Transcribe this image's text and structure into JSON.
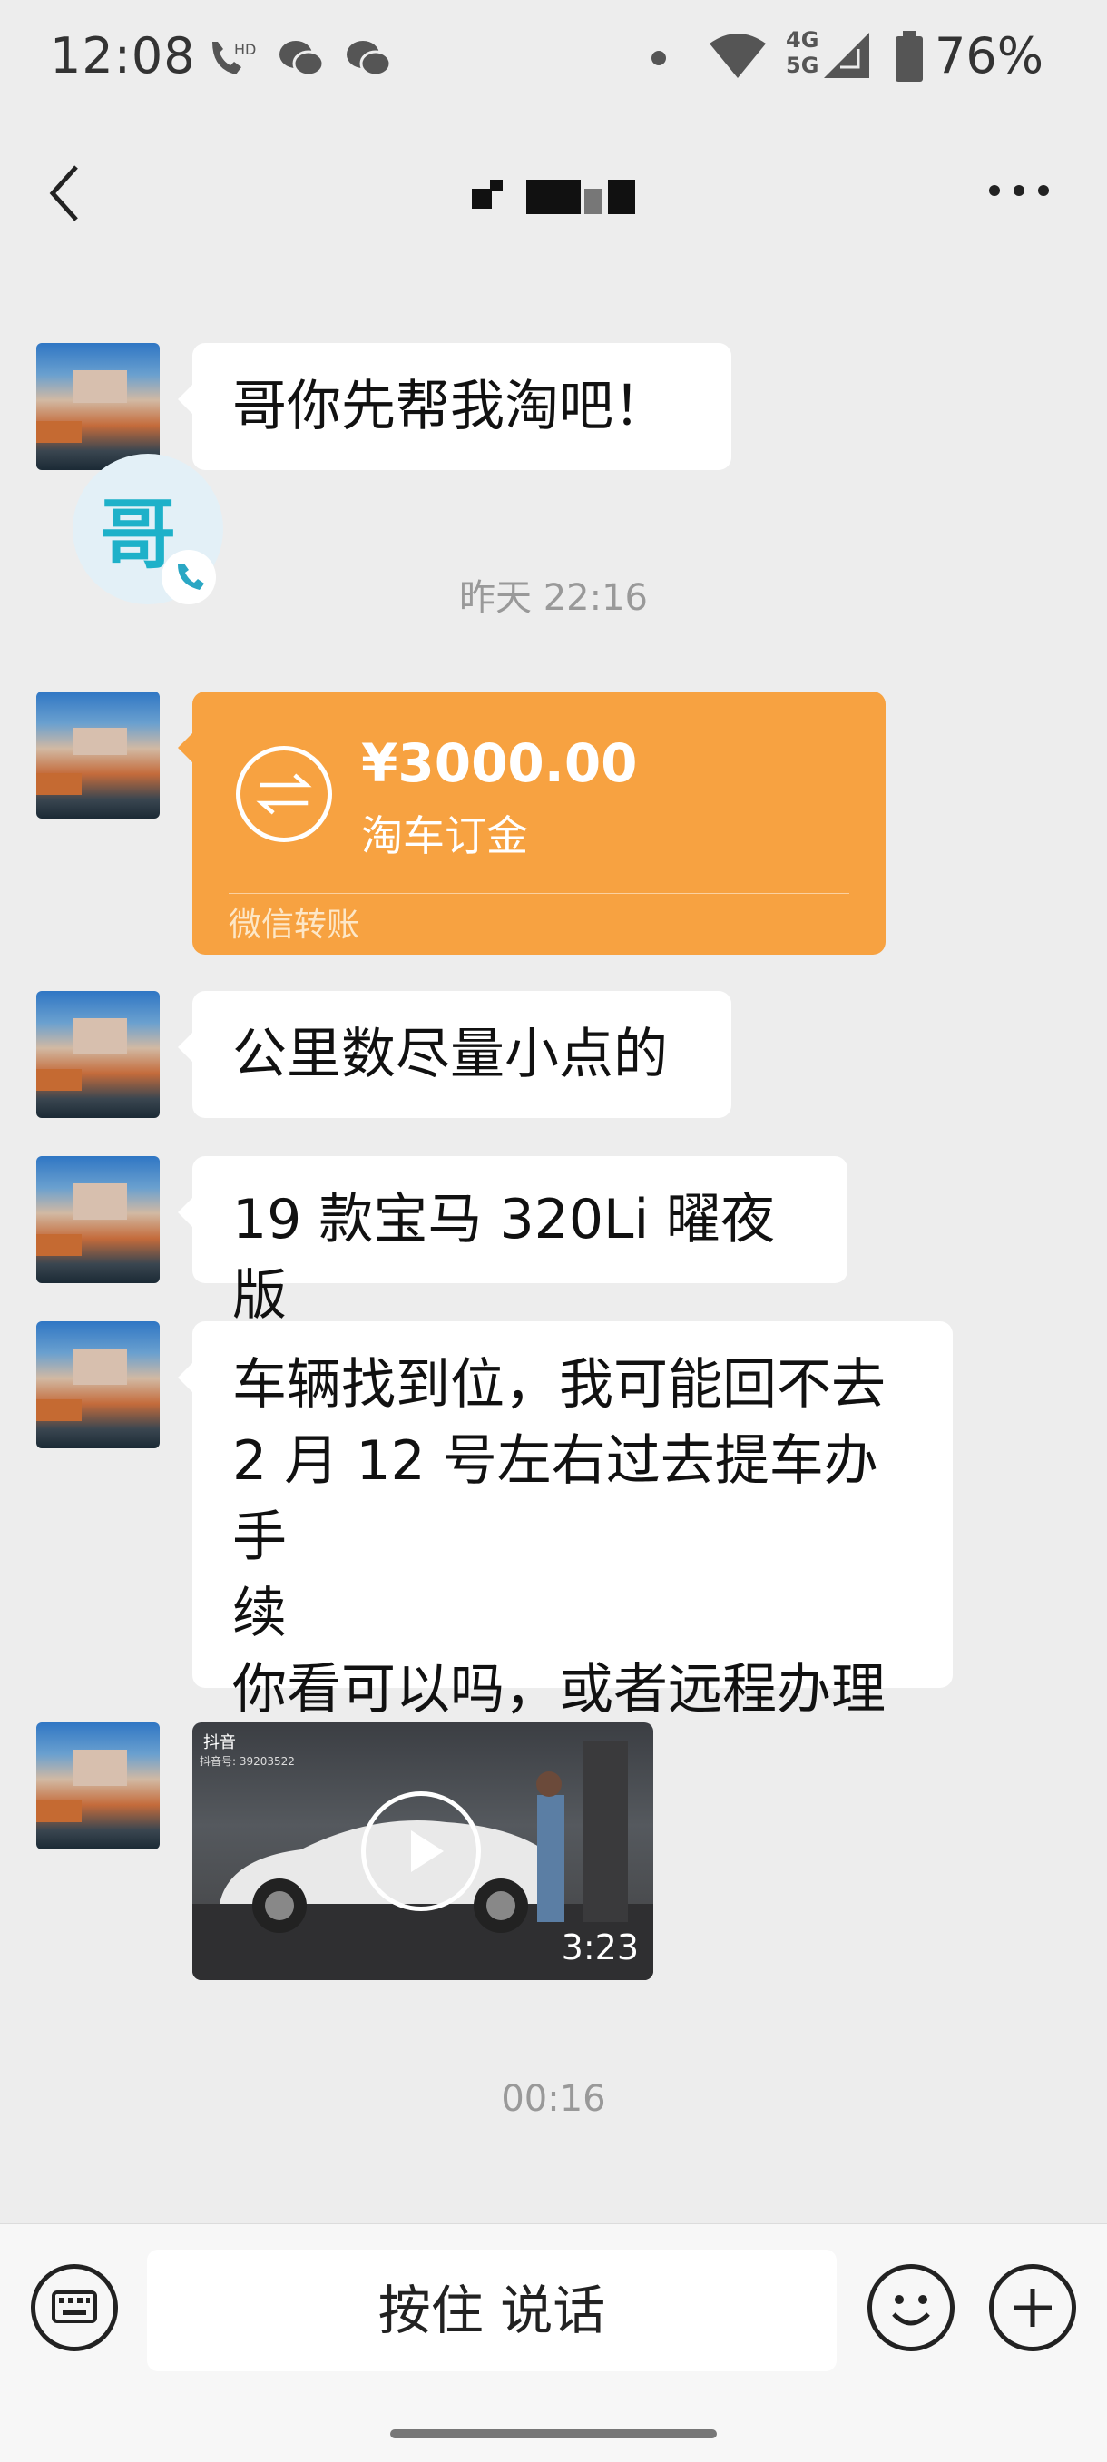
{
  "status_bar": {
    "time": "12:08",
    "hd_label": "HD",
    "network_top": "4G",
    "network_bottom": "5G",
    "battery": "76%",
    "icons": [
      "call-hd-icon",
      "wechat-icon",
      "wechat-icon",
      "dot-icon",
      "wifi-icon",
      "signal-icon",
      "battery-icon"
    ]
  },
  "nav": {
    "back_icon": "chevron-left-icon",
    "more_icon": "more-icon"
  },
  "float_badge": {
    "text": "哥"
  },
  "messages": [
    {
      "type": "text",
      "text": "哥你先帮我淘吧！"
    },
    {
      "type": "timestamp",
      "text": "昨天 22:16"
    },
    {
      "type": "transfer",
      "amount": "¥3000.00",
      "note": "淘车订金",
      "footer": "微信转账"
    },
    {
      "type": "text",
      "text": "公里数尽量小点的"
    },
    {
      "type": "text",
      "text": "19 款宝马 320Li 曜夜版"
    },
    {
      "type": "text",
      "lines": [
        "车辆找到位，我可能回不去",
        "2 月 12 号左右过去提车办手",
        "续",
        "你看可以吗，或者远程办理"
      ]
    },
    {
      "type": "video",
      "platform": "抖音",
      "account": "抖音号: 39203522",
      "duration": "3:23"
    },
    {
      "type": "timestamp",
      "text": "00:16"
    }
  ],
  "input_bar": {
    "voice_label": "按住 说话",
    "keyboard_icon": "keyboard-icon",
    "emoji_icon": "emoji-icon",
    "plus_icon": "plus-icon"
  },
  "colors": {
    "background": "#ededed",
    "transfer": "#f7a241",
    "bubble": "#ffffff"
  }
}
